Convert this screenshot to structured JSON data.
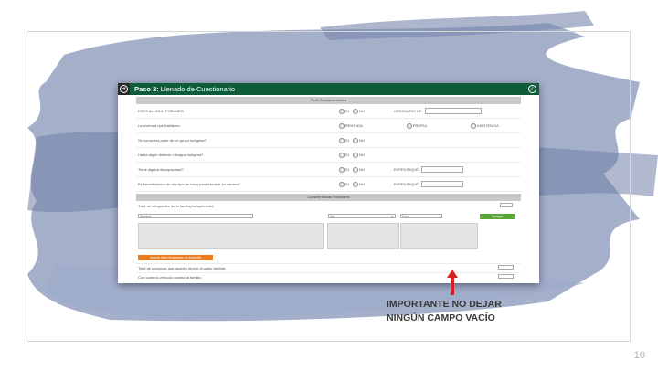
{
  "slide": {
    "number": "10"
  },
  "header": {
    "step": "Paso 3:",
    "title": "Llenado de Cuestionario"
  },
  "perfil": {
    "section_title": "Perfil Socioeconómico",
    "rows": [
      {
        "question": "ERES ALUMNO FORANEO",
        "options": [
          "SI",
          "NO"
        ],
        "extra_label": "ORIGINARIO DE:"
      },
      {
        "question": "La vivienda que habita es:",
        "options": [
          "RENTADA",
          "PROPIA",
          "ASISTENCIA"
        ],
        "extra_label": ""
      },
      {
        "question": "Se considera parte de un grupo indígena?",
        "options": [
          "SI",
          "NO"
        ],
        "extra_label": ""
      },
      {
        "question": "Habla algún dialecto o lengua indígena?",
        "options": [
          "SI",
          "NO"
        ],
        "extra_label": ""
      },
      {
        "question": "Tiene alguna discapacidad?",
        "options": [
          "SI",
          "NO"
        ],
        "extra_label": "ESPECIFIQUE:"
      },
      {
        "question": "Es beneficiario/a de otro tipo de beca para estudiar su carrera?",
        "options": [
          "SI",
          "NO"
        ],
        "extra_label": "ESPECIFIQUE:"
      }
    ]
  },
  "familia": {
    "section_title": "Características Familiares",
    "total_label": "Total de integrantes de la familia(incluyéndote):",
    "nombre_placeholder": "Nombre",
    "parentesco_value": "Sel.",
    "edad_placeholder": "Edad",
    "add_button": "Agregar",
    "clear_button": "Limpiar lista integrantes de la familia",
    "aportan_label": "Total de personas que aporten dinero al gasto familiar:",
    "vehiculos_label": "Con cuantos vehículo cuenta la familia:"
  },
  "note": {
    "line1": "IMPORTANTE NO DEJAR",
    "line2": "NINGÚN CAMPO VACÍO"
  },
  "colors": {
    "header_green": "#0f5c3a",
    "button_green": "#5aa436",
    "button_orange": "#ef7a1a",
    "arrow_red": "#d81f1f",
    "brush_blue": "#8f9fbf"
  }
}
